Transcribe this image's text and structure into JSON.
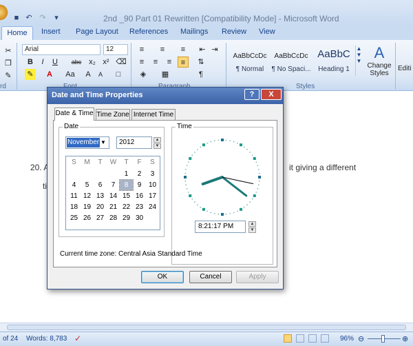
{
  "window": {
    "title": "2nd _90 Part 01 Rewritten [Compatibility Mode] - Microsoft Word"
  },
  "ribbon": {
    "tabs": [
      "Home",
      "Insert",
      "Page Layout",
      "References",
      "Mailings",
      "Review",
      "View"
    ],
    "font_name": "Arial",
    "font_size": "12",
    "styles": [
      {
        "sample": "AaBbCcDc",
        "name": "¶ Normal"
      },
      {
        "sample": "AaBbCcDc",
        "name": "¶ No Spaci..."
      },
      {
        "sample": "AaBbC",
        "name": "Heading 1"
      }
    ],
    "change_styles_label": "Change",
    "change_styles_label2": "Styles",
    "editing_label": "Editi",
    "group_font": "Font",
    "group_paragraph": "Paragraph",
    "group_styles": "Styles",
    "group_clipboard_partial": "rd"
  },
  "document": {
    "line1_left": "20. A",
    "line1_right": "it  giving  a  different",
    "line2_left": "ti"
  },
  "status": {
    "page": "of 24",
    "words": "Words: 8,783",
    "zoom": "96%"
  },
  "dialog": {
    "title": "Date and Time Properties",
    "help_label": "?",
    "close_label": "X",
    "tabs": [
      "Date & Time",
      "Time Zone",
      "Internet Time"
    ],
    "date_legend": "Date",
    "time_legend": "Time",
    "month": "November",
    "year": "2012",
    "weekday_headers": [
      "S",
      "M",
      "T",
      "W",
      "T",
      "F",
      "S"
    ],
    "weeks": [
      [
        "",
        "",
        "",
        "",
        "1",
        "2",
        "3"
      ],
      [
        "4",
        "5",
        "6",
        "7",
        "8",
        "9",
        "10"
      ],
      [
        "11",
        "12",
        "13",
        "14",
        "15",
        "16",
        "17"
      ],
      [
        "18",
        "19",
        "20",
        "21",
        "22",
        "23",
        "24"
      ],
      [
        "25",
        "26",
        "27",
        "28",
        "29",
        "30",
        ""
      ]
    ],
    "selected_day": "8",
    "time_value": "8:21:17 PM",
    "clock": {
      "hour": 8,
      "minute": 21,
      "second": 17
    },
    "timezone_text": "Current time zone:  Central Asia Standard Time",
    "ok_label": "OK",
    "cancel_label": "Cancel",
    "apply_label": "Apply"
  }
}
